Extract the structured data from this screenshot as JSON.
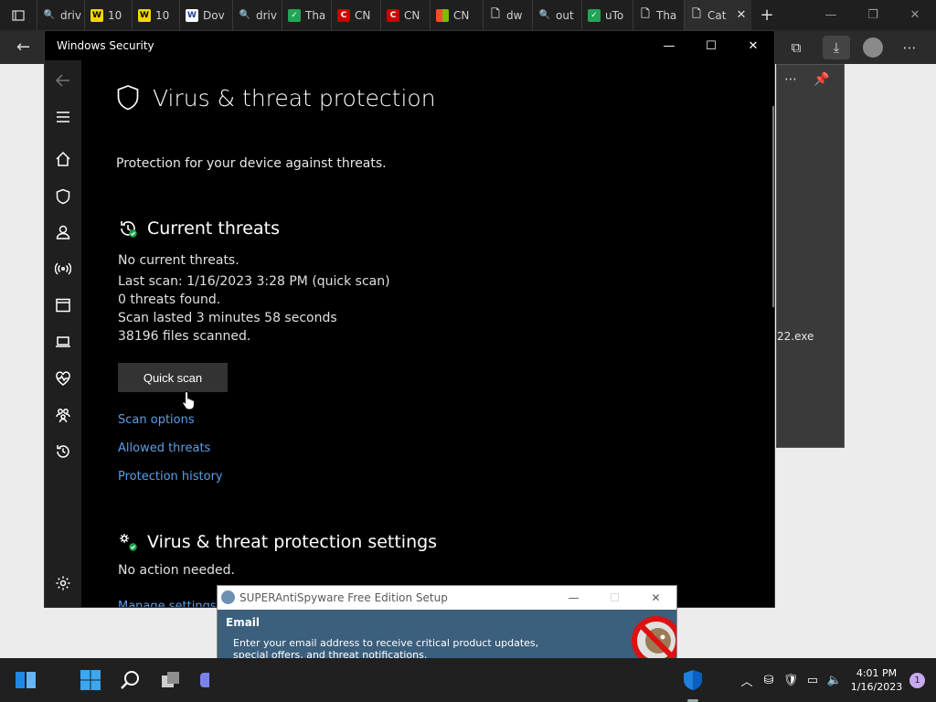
{
  "browser": {
    "tabs": [
      {
        "label": "driv",
        "icon": "search-icon",
        "color": "#0078d4"
      },
      {
        "label": "10",
        "icon": "w-icon",
        "color": "#f2d600"
      },
      {
        "label": "10",
        "icon": "w-icon",
        "color": "#f2d600"
      },
      {
        "label": "Dov",
        "icon": "w-icon",
        "color": "#ffffff"
      },
      {
        "label": "driv",
        "icon": "search-icon",
        "color": "#0078d4"
      },
      {
        "label": "Tha",
        "icon": "v-icon",
        "color": "#23a455"
      },
      {
        "label": "CN",
        "icon": "c-icon",
        "color": "#cc0000"
      },
      {
        "label": "CN",
        "icon": "c-icon",
        "color": "#cc0000"
      },
      {
        "label": "CN",
        "icon": "windows-icon",
        "color": "#f25022"
      },
      {
        "label": "dw",
        "icon": "page-icon",
        "color": "#cccccc"
      },
      {
        "label": "out",
        "icon": "search-icon",
        "color": "#0078d4"
      },
      {
        "label": "uTo",
        "icon": "v-icon",
        "color": "#23a455"
      },
      {
        "label": "Tha",
        "icon": "page-icon",
        "color": "#cccccc"
      },
      {
        "label": "Cat",
        "icon": "page-icon",
        "color": "#cccccc",
        "active": true
      }
    ],
    "download_file": "22.exe"
  },
  "security": {
    "window_title": "Windows Security",
    "page_title": "Virus & threat protection",
    "subtitle": "Protection for your device against threats.",
    "current_threats": {
      "heading": "Current threats",
      "no_threats": "No current threats.",
      "last_scan": "Last scan: 1/16/2023 3:28 PM (quick scan)",
      "threats_found": "0 threats found.",
      "scan_duration": "Scan lasted 3 minutes 58 seconds",
      "files_scanned": "38196 files scanned.",
      "quick_scan_label": "Quick scan",
      "links": [
        "Scan options",
        "Allowed threats",
        "Protection history"
      ]
    },
    "settings": {
      "heading": "Virus & threat protection settings",
      "status": "No action needed.",
      "manage_link": "Manage settings"
    }
  },
  "setup_dialog": {
    "title": "SUPERAntiSpyware Free Edition Setup",
    "section_title": "Email",
    "description": "Enter your email address to receive critical product updates, special offers, and threat notifications."
  },
  "taskbar": {
    "time": "4:01 PM",
    "date": "1/16/2023",
    "notification_count": "1"
  }
}
